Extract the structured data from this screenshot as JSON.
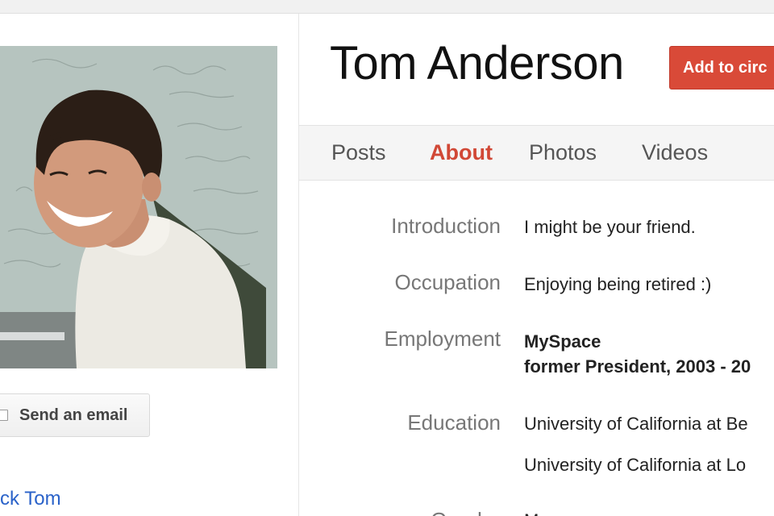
{
  "profile": {
    "name": "Tom Anderson",
    "add_to_circles_label": "Add to circ",
    "send_email_label": "Send an email",
    "block_label": "ck Tom"
  },
  "tabs": [
    {
      "label": "Posts",
      "active": false
    },
    {
      "label": "About",
      "active": true
    },
    {
      "label": "Photos",
      "active": false
    },
    {
      "label": "Videos",
      "active": false
    }
  ],
  "about": {
    "introduction": {
      "label": "Introduction",
      "value": "I might be your friend."
    },
    "occupation": {
      "label": "Occupation",
      "value": "Enjoying being retired :)"
    },
    "employment": {
      "label": "Employment",
      "company": "MySpace",
      "detail": "former President, 2003 - 20"
    },
    "education": {
      "label": "Education",
      "school_1": "University of California at Be",
      "school_2": "University of California at Lo"
    },
    "gender": {
      "label": "Gender",
      "value": "Ma"
    }
  },
  "colors": {
    "accent_red": "#d94a38",
    "active_tab": "#d14836",
    "link_blue": "#2a62c9"
  }
}
